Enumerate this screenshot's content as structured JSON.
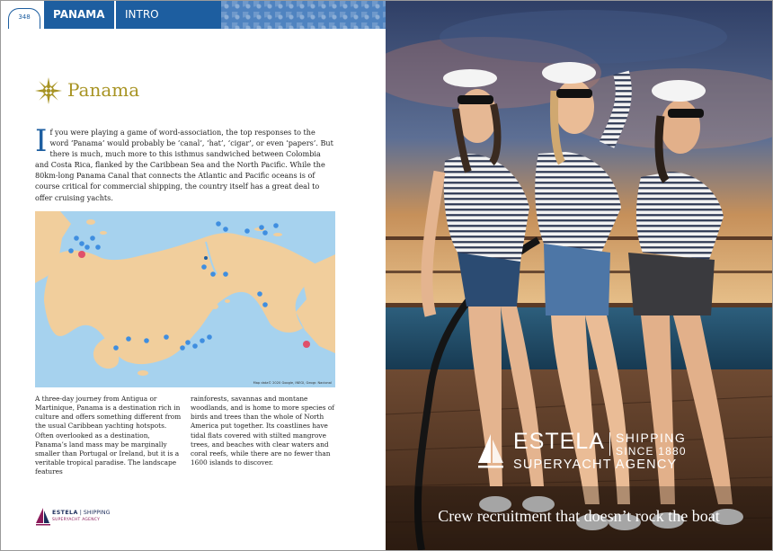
{
  "header": {
    "page_number": "348",
    "section": "PANAMA",
    "subsection": "INTRO"
  },
  "article": {
    "title": "Panama",
    "dropcap": "I",
    "intro": "f you were playing a game of word-association, the top responses to the word ‘Panama’ would probably be ‘canal’, ‘hat’, ‘cigar’, or even ‘papers’. But there is much, much more to this isthmus sandwiched between Colombia and Costa Rica, flanked by the Caribbean Sea and the North Pacific. While the 80km-long Panama Canal that connects the Atlantic and Pacific oceans is of course critical for commercial shipping, the country itself has a great deal to offer cruising yachts.",
    "col1": "A three-day journey from Antigua or Martinique, Panama is a destination rich in culture and offers something different from the usual Caribbean yachting hotspots. Often overlooked as a destination, Panama’s land mass may be marginally smaller than Portugal or Ireland, but it is a veritable tropical paradise. The landscape features",
    "col2": "rainforests, savannas and montane woodlands, and is home to more species of birds and trees than the whole of North America put together. Its coastlines have tidal flats covered with stilted mangrove trees, and beaches with clear waters and coral reefs, while there are no fewer than 1600 islands to discover."
  },
  "map": {
    "credit": "Map data© 2020 Google, INEGI, Geogr. Nacional"
  },
  "footer_logo": {
    "name": "ESTELA",
    "tagline": "SHIPPING",
    "sub": "SUPERYACHT AGENCY"
  },
  "advert": {
    "brand": "ESTELA",
    "shipping": "SHIPPING",
    "since": "SINCE 1880",
    "agency": "SUPERYACHT AGENCY",
    "slogan": "Crew recruitment that doesn’t rock the boat"
  },
  "colors": {
    "header_blue": "#1d5ea0",
    "title_gold": "#a89424",
    "map_water": "#a6d2ee",
    "map_land": "#f1ce9c",
    "pin_blue": "#3f8ee0",
    "pin_red": "#e0506a"
  }
}
